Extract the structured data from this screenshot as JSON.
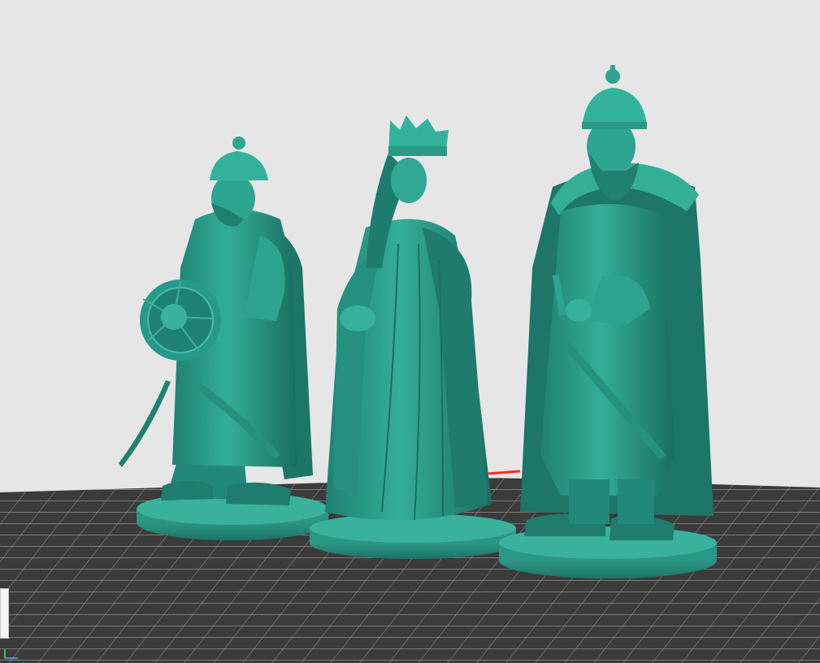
{
  "viewport": {
    "background": "#e6e6e6",
    "bed_color": "#3a3a3a",
    "grid_color": "#9a9a9a",
    "bed_edge_color": "#ff2020"
  },
  "model": {
    "color": "#2a9e8a",
    "shade_color": "#1d7a6a",
    "highlight_color": "#45c2ab"
  },
  "figures": [
    {
      "name": "warrior-with-shield-figure"
    },
    {
      "name": "queen-with-crown-figure"
    },
    {
      "name": "bearded-warrior-with-cloak-figure"
    }
  ],
  "icons": {
    "axis": "axis-indicator-icon"
  }
}
